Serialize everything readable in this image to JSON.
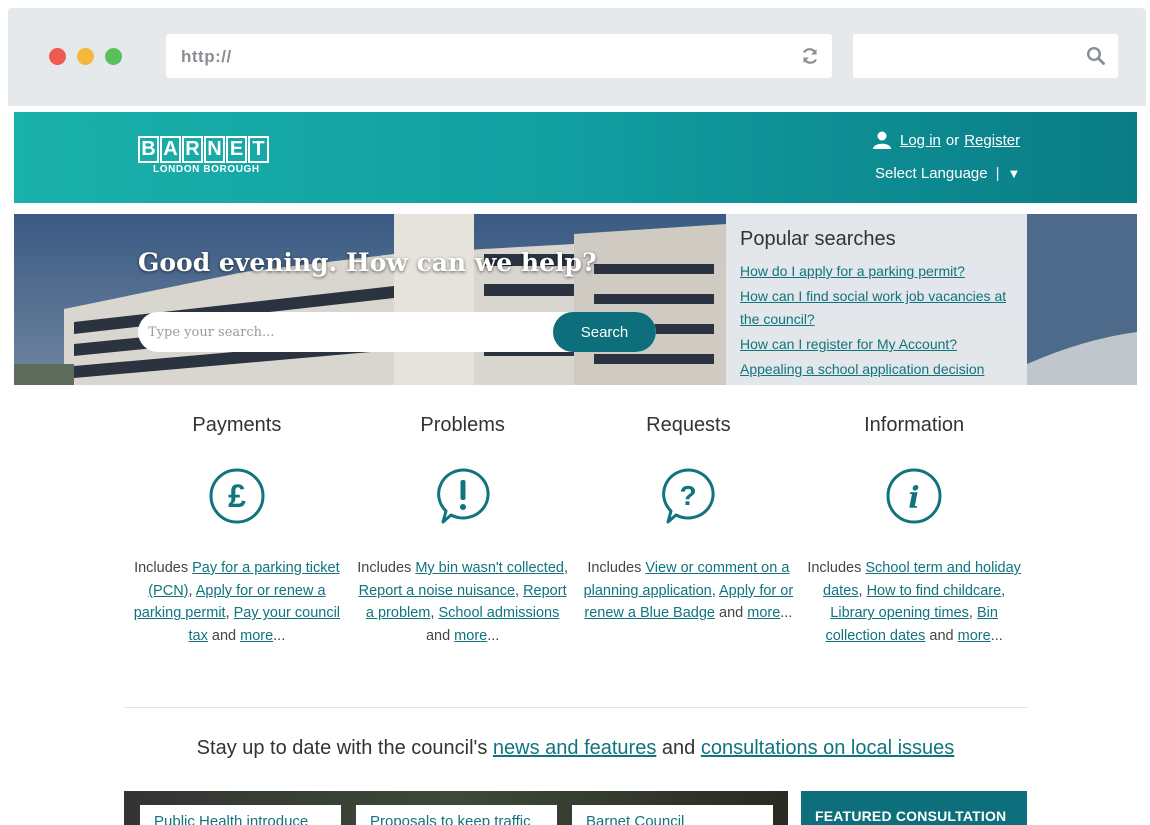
{
  "browser": {
    "url": "http://",
    "colors": {
      "close": "#ee5a4f",
      "minimize": "#f5b73d",
      "maximize": "#5ac05b"
    }
  },
  "header": {
    "logo_letters": [
      "B",
      "A",
      "R",
      "N",
      "E",
      "T"
    ],
    "logo_sub": "LONDON BOROUGH",
    "login_label": "Log in",
    "or_label": "or",
    "register_label": "Register",
    "language_label": "Select Language",
    "language_sep": "|",
    "language_caret": "▼"
  },
  "hero": {
    "title": "Good evening. How can we help?",
    "search_placeholder": "Type your search...",
    "search_button": "Search",
    "popular_title": "Popular searches",
    "popular_links": [
      "How do I apply for a parking permit?",
      "How can I find social work job vacancies at the council?",
      "How can I register for My Account?",
      "Appealing a school application decision"
    ]
  },
  "categories": [
    {
      "title": "Payments",
      "icon": "pound-icon",
      "prefix": "Includes",
      "links": [
        "Pay for a parking ticket (PCN)",
        "Apply for or renew a parking permit",
        "Pay your council tax"
      ],
      "and": "and",
      "more": "more",
      "ellipsis": "..."
    },
    {
      "title": "Problems",
      "icon": "exclamation-icon",
      "prefix": "Includes",
      "links": [
        "My bin wasn't collected",
        "Report a noise nuisance",
        "Report a problem",
        "School admissions"
      ],
      "and": "and",
      "more": "more",
      "ellipsis": "..."
    },
    {
      "title": "Requests",
      "icon": "question-icon",
      "prefix": "Includes",
      "links": [
        "View or comment on a planning application",
        "Apply for or renew a Blue Badge"
      ],
      "and": "and",
      "more": "more",
      "ellipsis": "..."
    },
    {
      "title": "Information",
      "icon": "info-icon",
      "prefix": "Includes",
      "links": [
        "School term and holiday dates",
        "How to find childcare",
        "Library opening times",
        "Bin collection dates"
      ],
      "and": "and",
      "more": "more",
      "ellipsis": "..."
    }
  ],
  "stay": {
    "text_before": "Stay up to date with the council's",
    "news_link": "news and features",
    "and": "and",
    "consult_link": "consultations on local issues"
  },
  "news_cards": [
    "Public Health introduce",
    "Proposals to keep traffic",
    "Barnet Council"
  ],
  "featured_label": "FEATURED CONSULTATION",
  "theme": {
    "teal": "#10747f",
    "header_start": "#1ab1aa",
    "header_end": "#0a7c86"
  }
}
